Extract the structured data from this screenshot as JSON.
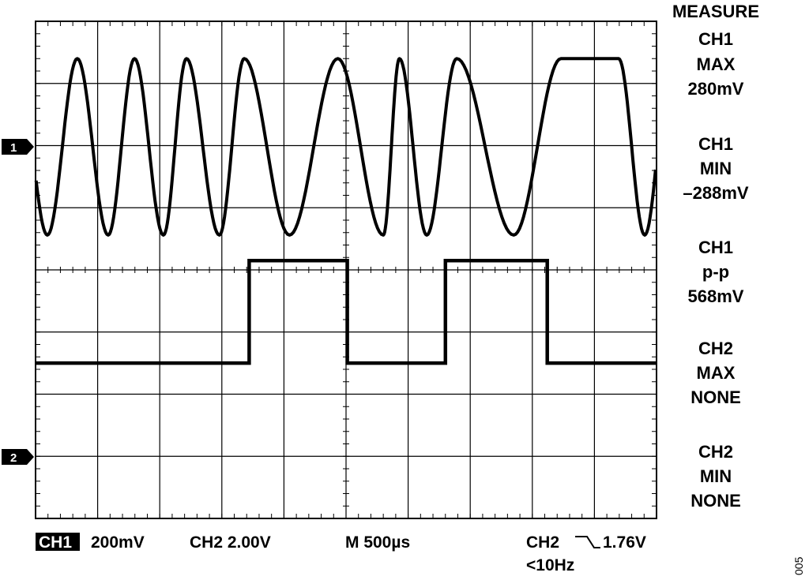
{
  "chart_data": {
    "type": "line",
    "title": "",
    "grid": true,
    "divisions": {
      "horizontal": 10,
      "vertical": 8
    },
    "measure": {
      "header": "MEASURE",
      "items": [
        {
          "channel": "CH1",
          "name": "MAX",
          "value": "280mV"
        },
        {
          "channel": "CH1",
          "name": "MIN",
          "value": "–288mV"
        },
        {
          "channel": "CH1",
          "name": "p-p",
          "value": "568mV"
        },
        {
          "channel": "CH2",
          "name": "MAX",
          "value": "NONE"
        },
        {
          "channel": "CH2",
          "name": "MIN",
          "value": "NONE"
        }
      ]
    },
    "channel_markers": [
      "1",
      "2"
    ],
    "status_bar": {
      "ch1_label": "CH1",
      "ch1_scale": "200mV",
      "ch2_scale": "CH2 2.00V",
      "timebase": "M 500µs",
      "trigger_source": "CH2",
      "trigger_level": "1.76V",
      "frequency": "<10Hz"
    },
    "series": [
      {
        "name": "CH1",
        "units": "V",
        "time_unit": "ms",
        "ground_div": 2,
        "volts_per_div": 0.2,
        "waveform": "sine",
        "amplitude": 0.284,
        "offset": -0.004,
        "peaks_ms": [
          0.336,
          0.797,
          1.215,
          1.68,
          2.434,
          2.93,
          3.391,
          4.231,
          4.695
        ],
        "troughs_ms": [
          0.095,
          0.585,
          1.03,
          1.48,
          2.045,
          2.8,
          3.15,
          3.85,
          4.905
        ]
      },
      {
        "name": "CH2",
        "units": "V",
        "time_unit": "ms",
        "ground_div": 5.5,
        "volts_per_div": 2.0,
        "waveform": "square",
        "low": 0.0,
        "high": 3.3,
        "edges_ms": [
          {
            "t": 1.72,
            "to": "high"
          },
          {
            "t": 2.51,
            "to": "low"
          },
          {
            "t": 3.3,
            "to": "high"
          },
          {
            "t": 4.12,
            "to": "low"
          }
        ]
      }
    ],
    "x_range_ms": [
      0,
      5
    ],
    "colors": {
      "trace": "#000000",
      "grid": "#000000",
      "background": "#ffffff"
    }
  },
  "figure_id": "005"
}
